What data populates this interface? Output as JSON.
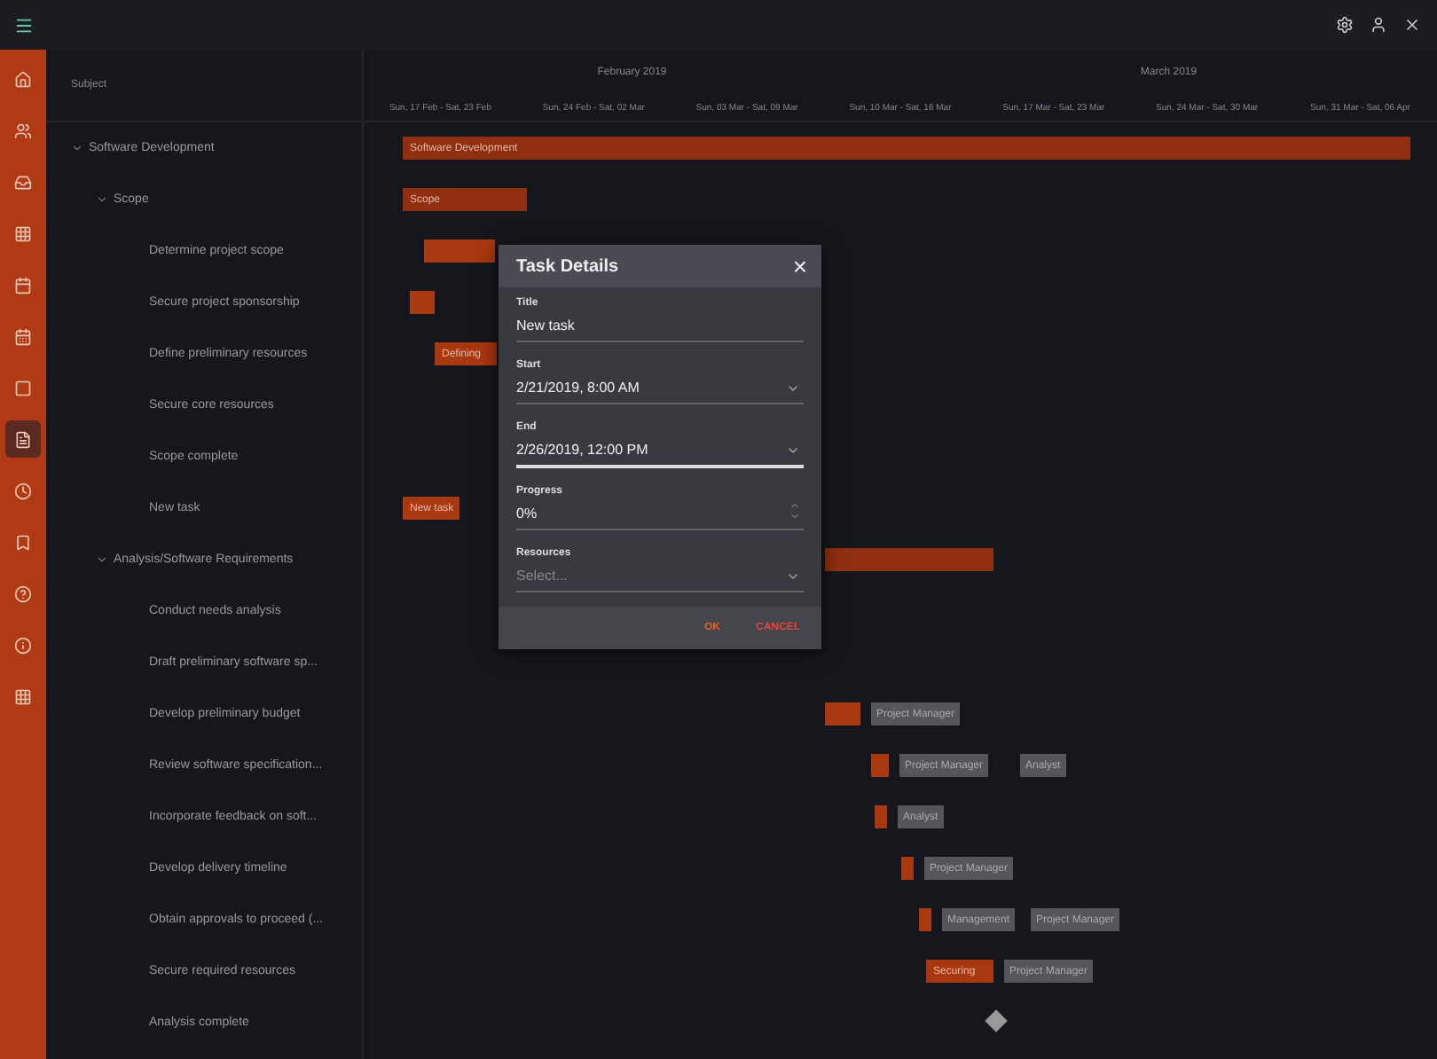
{
  "sidebar": {
    "items": [
      {
        "selected": false
      },
      {
        "selected": false
      },
      {
        "selected": false
      },
      {
        "selected": false
      },
      {
        "selected": false
      },
      {
        "selected": false
      },
      {
        "selected": false
      },
      {
        "selected": true
      },
      {
        "selected": false
      },
      {
        "selected": false
      },
      {
        "selected": false
      },
      {
        "selected": false
      },
      {
        "selected": false
      }
    ]
  },
  "tree": {
    "column": "Subject",
    "tasks": [
      {
        "title": "Software Development",
        "expanded": true,
        "bar": {
          "kind": "summary",
          "label": "Software Development"
        },
        "children": [
          {
            "title": "Scope",
            "expanded": true,
            "bar": {
              "kind": "summary",
              "label": "Scope"
            },
            "children": [
              {
                "title": "Determine project scope",
                "bar": {
                  "kind": "task"
                }
              },
              {
                "title": "Secure project sponsorship",
                "bar": {
                  "kind": "task"
                }
              },
              {
                "title": "Define preliminary resources",
                "bar": {
                  "kind": "task",
                  "label": "Defining"
                }
              },
              {
                "title": "Secure core resources"
              },
              {
                "title": "Scope complete"
              },
              {
                "title": "New task",
                "bar": {
                  "kind": "task",
                  "label": "New task"
                }
              }
            ]
          },
          {
            "title": "Analysis/Software Requirements",
            "expanded": true,
            "bar": {
              "kind": "summary"
            },
            "children": [
              {
                "title": "Conduct needs analysis"
              },
              {
                "title": "Draft preliminary software sp..."
              },
              {
                "title": "Develop preliminary budget",
                "bar": {
                  "kind": "task",
                  "resources": [
                    "Project Manager"
                  ]
                }
              },
              {
                "title": "Review software specification...",
                "bar": {
                  "kind": "task",
                  "resources": [
                    "Project Manager",
                    "Analyst"
                  ]
                }
              },
              {
                "title": "Incorporate feedback on soft...",
                "bar": {
                  "kind": "task",
                  "resources": [
                    "Analyst"
                  ]
                }
              },
              {
                "title": "Develop delivery timeline",
                "bar": {
                  "kind": "task",
                  "resources": [
                    "Project Manager"
                  ]
                }
              },
              {
                "title": "Obtain approvals to proceed (...",
                "bar": {
                  "kind": "task",
                  "resources": [
                    "Management",
                    "Project Manager"
                  ]
                }
              },
              {
                "title": "Secure required resources",
                "bar": {
                  "kind": "task",
                  "label": "Securing",
                  "resources": [
                    "Project Manager"
                  ]
                }
              },
              {
                "title": "Analysis complete",
                "bar": {
                  "kind": "milestone"
                }
              }
            ]
          }
        ]
      }
    ]
  },
  "timescale": {
    "months": [
      "February 2019",
      "March 2019"
    ],
    "weeks": [
      "Sun, 17 Feb - Sat, 23 Feb",
      "Sun, 24 Feb - Sat, 02 Mar",
      "Sun, 03 Mar - Sat, 09 Mar",
      "Sun, 10 Mar - Sat, 16 Mar",
      "Sun, 17 Mar - Sat, 23 Mar",
      "Sun, 24 Mar - Sat, 30 Mar",
      "Sun, 31 Mar - Sat, 06 Apr"
    ]
  },
  "dialog": {
    "title": "Task Details",
    "close": "×",
    "fields": [
      {
        "kind": "text",
        "label": "Title",
        "value": "New task",
        "focused": false
      },
      {
        "kind": "date",
        "label": "Start",
        "value": "2/21/2019, 8:00 AM",
        "focused": false
      },
      {
        "kind": "date",
        "label": "End",
        "value": "2/26/2019, 12:00 PM",
        "focused": true
      },
      {
        "kind": "number",
        "label": "Progress",
        "value": "0%",
        "focused": false
      },
      {
        "kind": "select",
        "label": "Resources",
        "placeholder": "Select...",
        "focused": false
      }
    ],
    "buttons": [
      "OK",
      "CANCEL"
    ]
  }
}
